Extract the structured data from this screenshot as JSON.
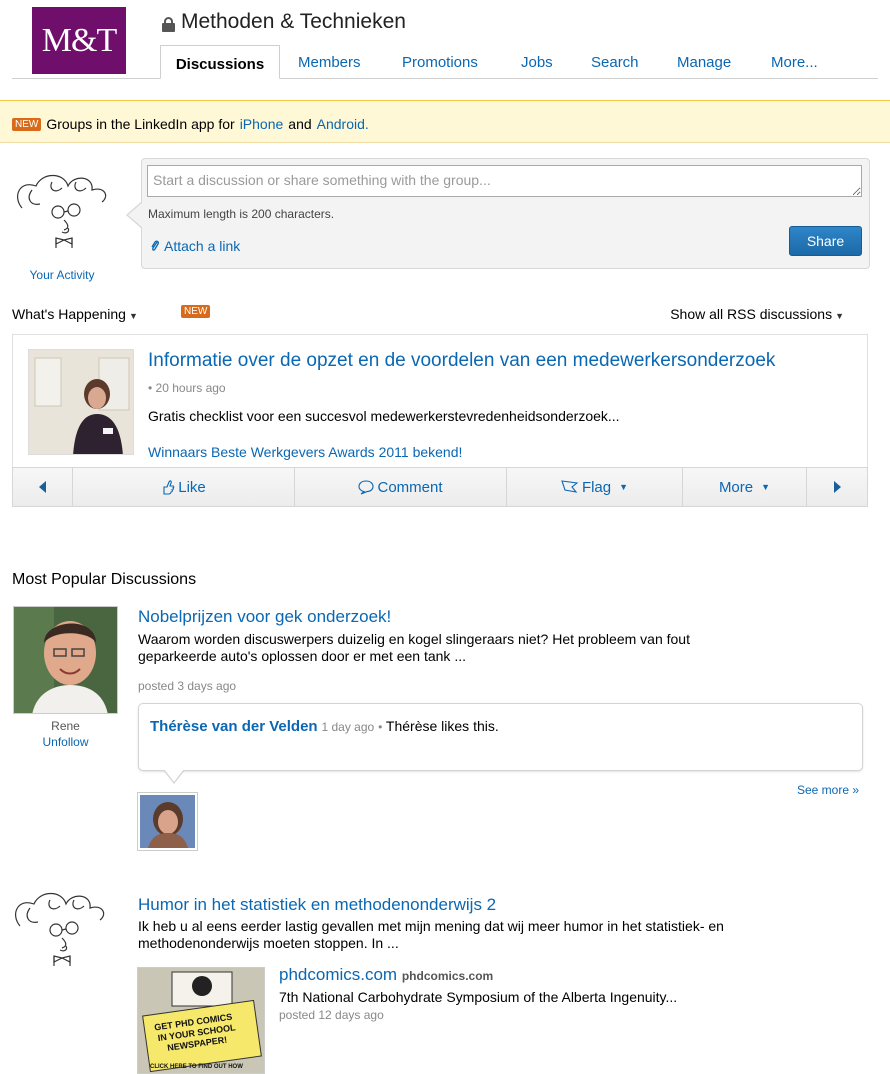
{
  "colors": {
    "link": "#0a67b3",
    "brand_purple": "#6f0f6b",
    "share_button": "#1c6aa8",
    "new_badge": "#d86b1a",
    "notice_bg": "#fff8d6"
  },
  "group": {
    "logo_text": "M&T",
    "title": "Methoden & Technieken",
    "lock_icon": "lock-icon"
  },
  "tabs": [
    {
      "label": "Discussions",
      "active": true
    },
    {
      "label": "Members"
    },
    {
      "label": "Promotions"
    },
    {
      "label": "Jobs"
    },
    {
      "label": "Search"
    },
    {
      "label": "Manage"
    },
    {
      "label": "More..."
    }
  ],
  "notice": {
    "badge": "NEW",
    "text_before": "Groups in the LinkedIn app for",
    "iphone": "iPhone",
    "and": "and",
    "android": "Android."
  },
  "composer": {
    "placeholder": "Start a discussion or share something with the group...",
    "max_length_note": "Maximum length is 200 characters.",
    "attach_label": "Attach a link",
    "share_label": "Share",
    "your_activity": "Your Activity"
  },
  "feed_header": {
    "whats_happening": "What's Happening",
    "new_badge": "NEW",
    "rss_label": "Show all RSS discussions"
  },
  "feed_item": {
    "title": "Informatie over de opzet en de voordelen van een medewerkersonderzoek",
    "time": "• 20 hours ago",
    "description": "Gratis checklist voor een succesvol medewerkerstevredenheidsonderzoek...",
    "related_link": "Winnaars Beste Werkgevers Awards 2011 bekend!"
  },
  "action_bar": {
    "like": "Like",
    "comment": "Comment",
    "flag": "Flag",
    "more": "More"
  },
  "popular": {
    "section_title": "Most Popular Discussions",
    "discussions": [
      {
        "title": "Nobelprijzen voor gek onderzoek!",
        "snippet_line1": "Waarom worden discuswerpers duizelig en kogel slingeraars niet? Het probleem van fout",
        "snippet_line2": "geparkeerde auto's oplossen door er met een tank ...",
        "meta": "posted 3 days ago",
        "author_name": "Rene",
        "author_action": "Unfollow",
        "comment": {
          "author": "Thérèse van der Velden",
          "time": "1 day ago",
          "separator": "•",
          "text": "Thérèse likes this."
        },
        "see_more": "See more »"
      },
      {
        "title": "Humor in het statistiek en methodenonderwijs 2",
        "snippet_line1": "Ik heb u al eens eerder lastig gevallen met mijn mening dat wij meer humor in het statistiek- en",
        "snippet_line2": "methodenonderwijs moeten stoppen. In ...",
        "shared_link": {
          "title": "phdcomics.com",
          "domain": "phdcomics.com",
          "description": "7th National Carbohydrate Symposium of the Alberta Ingenuity...",
          "meta": "posted 12 days ago",
          "thumb_text_1": "GET PHD COMICS",
          "thumb_text_2": "IN YOUR SCHOOL",
          "thumb_text_3": "NEWSPAPER!",
          "thumb_text_4": "CLICK HERE TO FIND OUT HOW"
        }
      }
    ]
  }
}
